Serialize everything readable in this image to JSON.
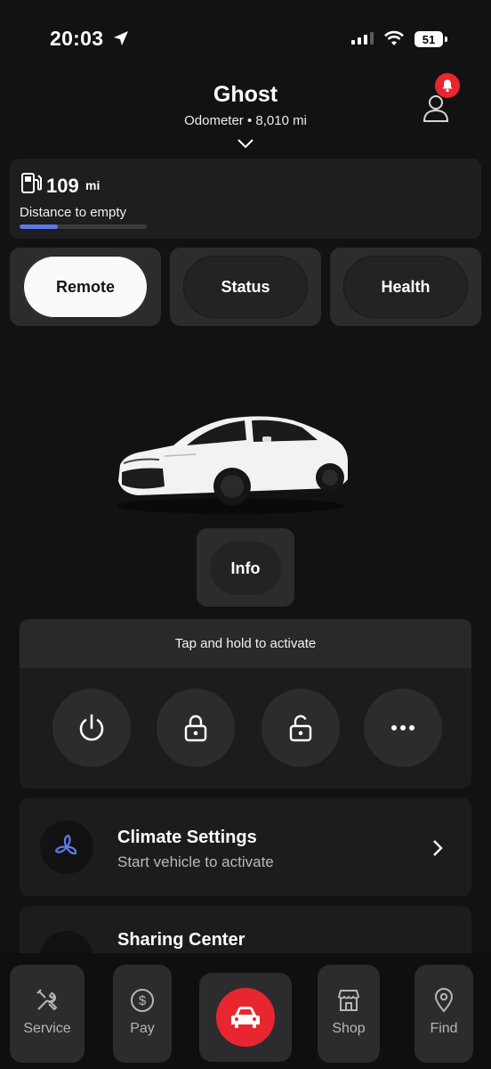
{
  "status_bar": {
    "time": "20:03",
    "battery": "51"
  },
  "header": {
    "vehicle_name": "Ghost",
    "odometer": "Odometer • 8,010 mi"
  },
  "fuel": {
    "value": "109",
    "unit": "mi",
    "label": "Distance to empty",
    "fill_fraction": 0.3
  },
  "tabs": [
    {
      "label": "Remote",
      "active": true
    },
    {
      "label": "Status",
      "active": false
    },
    {
      "label": "Health",
      "active": false
    }
  ],
  "info_button": {
    "label": "Info"
  },
  "remote": {
    "hint": "Tap and hold to activate",
    "buttons": [
      "power-icon",
      "lock-icon",
      "unlock-icon",
      "more-icon"
    ]
  },
  "climate": {
    "title": "Climate Settings",
    "subtitle": "Start vehicle to activate"
  },
  "sharing": {
    "title": "Sharing Center"
  },
  "nav": {
    "service": "Service",
    "pay": "Pay",
    "shop": "Shop",
    "find": "Find"
  },
  "colors": {
    "accent_red": "#e8262f",
    "fuel_bar": "#5b7be8",
    "climate_icon": "#5b7be8"
  }
}
